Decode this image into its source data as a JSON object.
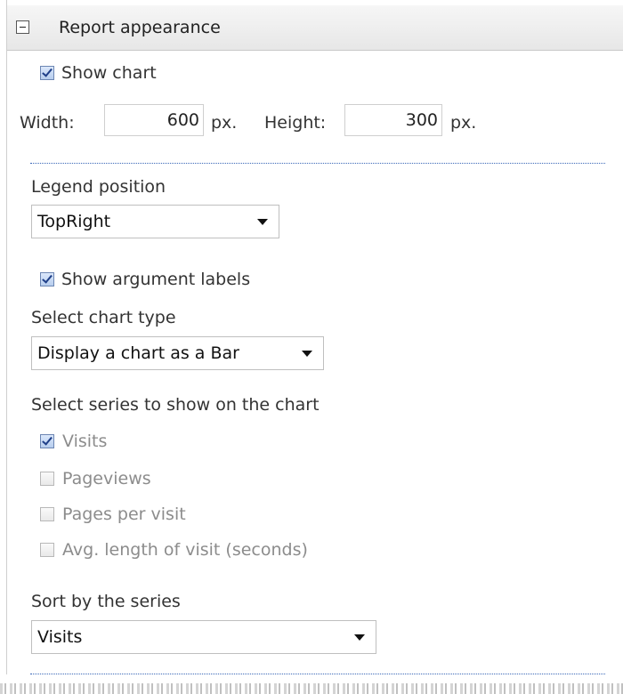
{
  "section": {
    "title": "Report appearance"
  },
  "show_chart": {
    "label": "Show chart",
    "checked": true
  },
  "size": {
    "width_label": "Width:",
    "width_value": "600",
    "width_unit": "px.",
    "height_label": "Height:",
    "height_value": "300",
    "height_unit": "px."
  },
  "legend": {
    "label": "Legend position",
    "selected": "TopRight"
  },
  "show_argument_labels": {
    "label": "Show argument labels",
    "checked": true
  },
  "chart_type": {
    "label": "Select chart type",
    "selected": "Display a chart as a Bar"
  },
  "series": {
    "label": "Select series to show on the chart",
    "items": [
      {
        "label": "Visits",
        "checked": true
      },
      {
        "label": "Pageviews",
        "checked": false
      },
      {
        "label": "Pages per visit",
        "checked": false
      },
      {
        "label": "Avg. length of visit (seconds)",
        "checked": false
      }
    ]
  },
  "sort": {
    "label": "Sort by the series",
    "selected": "Visits"
  },
  "icons": {
    "collapse": "minus-box-icon",
    "dropdown": "triangle-down-icon"
  }
}
